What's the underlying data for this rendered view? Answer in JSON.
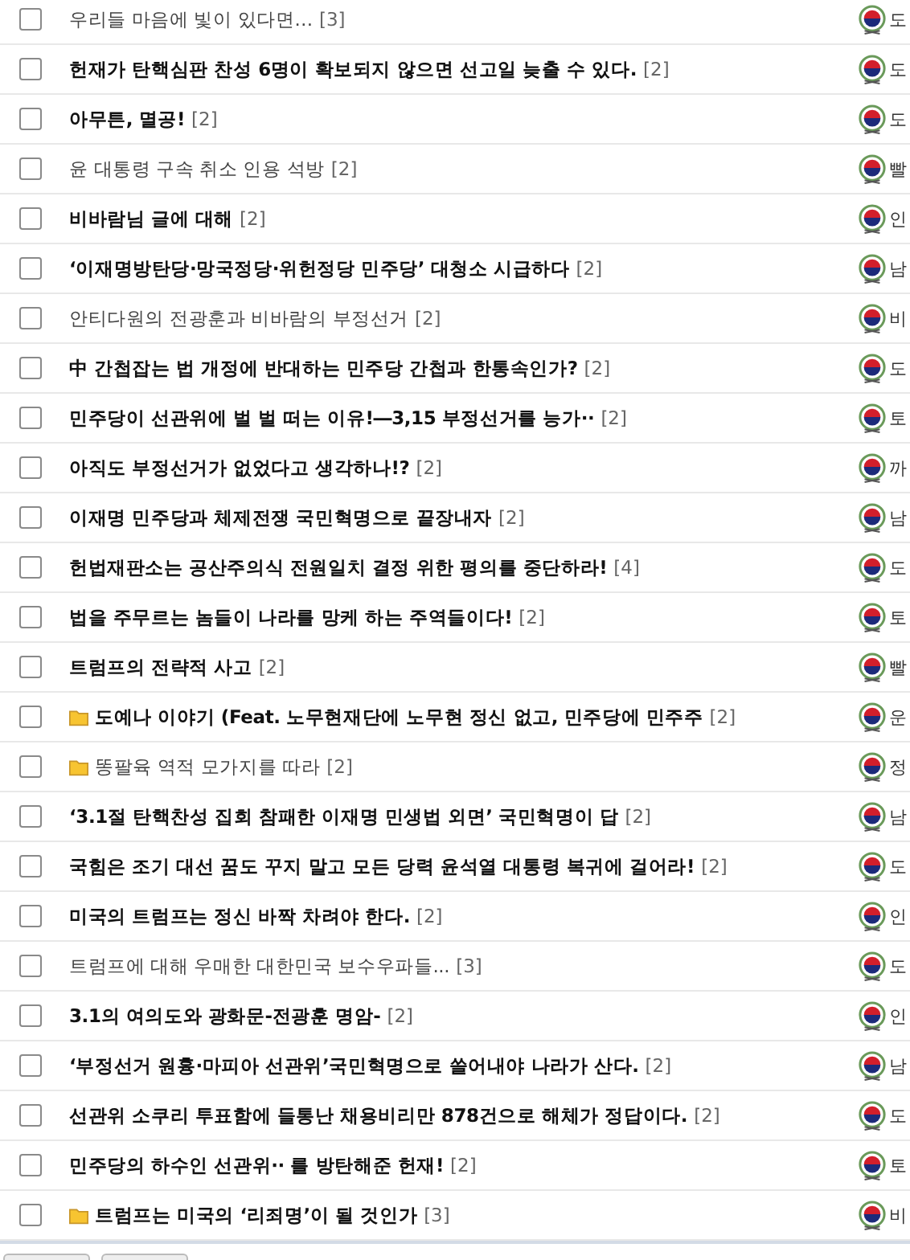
{
  "posts": [
    {
      "title": "우리들 마음에 빛이 있다면…",
      "comments": "[3]",
      "bold": false,
      "folder": false,
      "checked": false,
      "author": "도"
    },
    {
      "title": "헌재가 탄핵심판 찬성 6명이 확보되지 않으면 선고일 늦출 수 있다.",
      "comments": "[2]",
      "bold": true,
      "folder": false,
      "checked": false,
      "author": "도"
    },
    {
      "title": "아무튼, 멸공!",
      "comments": "[2]",
      "bold": true,
      "folder": false,
      "checked": false,
      "author": "도"
    },
    {
      "title": "윤 대통령 구속 취소 인용 석방",
      "comments": "[2]",
      "bold": false,
      "folder": false,
      "checked": false,
      "author": "빨"
    },
    {
      "title": "비바람님 글에 대해",
      "comments": "[2]",
      "bold": true,
      "folder": false,
      "checked": false,
      "author": "인"
    },
    {
      "title": "‘이재명방탄당·망국정당·위헌정당 민주당’ 대청소 시급하다",
      "comments": "[2]",
      "bold": true,
      "folder": false,
      "checked": false,
      "author": "남"
    },
    {
      "title": "안티다원의 전광훈과 비바람의 부정선거",
      "comments": "[2]",
      "bold": false,
      "folder": false,
      "checked": false,
      "author": "비"
    },
    {
      "title": "中 간첩잡는 법 개정에 반대하는 민주당 간첩과 한통속인가?",
      "comments": "[2]",
      "bold": true,
      "folder": false,
      "checked": false,
      "author": "도"
    },
    {
      "title": "민주당이 선관위에 벌 벌 떠는 이유!―3,15 부정선거를 능가··",
      "comments": "[2]",
      "bold": true,
      "folder": false,
      "checked": false,
      "author": "토"
    },
    {
      "title": "아직도 부정선거가 없었다고 생각하나!?",
      "comments": "[2]",
      "bold": true,
      "folder": false,
      "checked": false,
      "author": "까"
    },
    {
      "title": "이재명 민주당과 체제전쟁 국민혁명으로 끝장내자",
      "comments": "[2]",
      "bold": true,
      "folder": false,
      "checked": false,
      "author": "남"
    },
    {
      "title": "헌법재판소는 공산주의식 전원일치 결정 위한 평의를 중단하라!",
      "comments": "[4]",
      "bold": true,
      "folder": false,
      "checked": false,
      "author": "도"
    },
    {
      "title": "법을 주무르는 놈들이 나라를 망케 하는 주역들이다!",
      "comments": "[2]",
      "bold": true,
      "folder": false,
      "checked": false,
      "author": "토"
    },
    {
      "title": "트럼프의 전략적 사고",
      "comments": "[2]",
      "bold": true,
      "folder": false,
      "checked": false,
      "author": "빨"
    },
    {
      "title": "도예나 이야기 (Feat. 노무현재단에 노무현 정신 없고, 민주당에 민주주",
      "comments": "[2]",
      "bold": true,
      "folder": true,
      "checked": false,
      "author": "운"
    },
    {
      "title": "똥팔육 역적 모가지를 따라",
      "comments": "[2]",
      "bold": false,
      "folder": true,
      "checked": false,
      "author": "정"
    },
    {
      "title": "‘3.1절 탄핵찬성 집회 참패한 이재명 민생법 외면’ 국민혁명이 답",
      "comments": "[2]",
      "bold": true,
      "folder": false,
      "checked": false,
      "author": "남"
    },
    {
      "title": "국힘은 조기 대선 꿈도 꾸지 말고 모든 당력 윤석열 대통령 복귀에 걸어라!",
      "comments": "[2]",
      "bold": true,
      "folder": false,
      "checked": false,
      "author": "도"
    },
    {
      "title": "미국의 트럼프는 정신 바짝 차려야 한다.",
      "comments": "[2]",
      "bold": true,
      "folder": false,
      "checked": false,
      "author": "인"
    },
    {
      "title": "트럼프에 대해 우매한 대한민국 보수우파들...",
      "comments": "[3]",
      "bold": false,
      "folder": false,
      "checked": false,
      "author": "도"
    },
    {
      "title": "3.1의 여의도와 광화문-전광훈 명암-",
      "comments": "[2]",
      "bold": true,
      "folder": false,
      "checked": false,
      "author": "인"
    },
    {
      "title": "‘부정선거 원흉·마피아 선관위’국민혁명으로 쓸어내야 나라가 산다.",
      "comments": "[2]",
      "bold": true,
      "folder": false,
      "checked": false,
      "author": "남"
    },
    {
      "title": "선관위 소쿠리 투표함에 들통난 채용비리만 878건으로 해체가 정답이다.",
      "comments": "[2]",
      "bold": true,
      "folder": false,
      "checked": false,
      "author": "도"
    },
    {
      "title": "민주당의 하수인 선관위·· 를 방탄해준 헌재!",
      "comments": "[2]",
      "bold": true,
      "folder": false,
      "checked": false,
      "author": "토"
    },
    {
      "title": "트럼프는 미국의 ‘리죄명’이 될 것인가",
      "comments": "[3]",
      "bold": true,
      "folder": true,
      "checked": false,
      "author": "비"
    }
  ]
}
